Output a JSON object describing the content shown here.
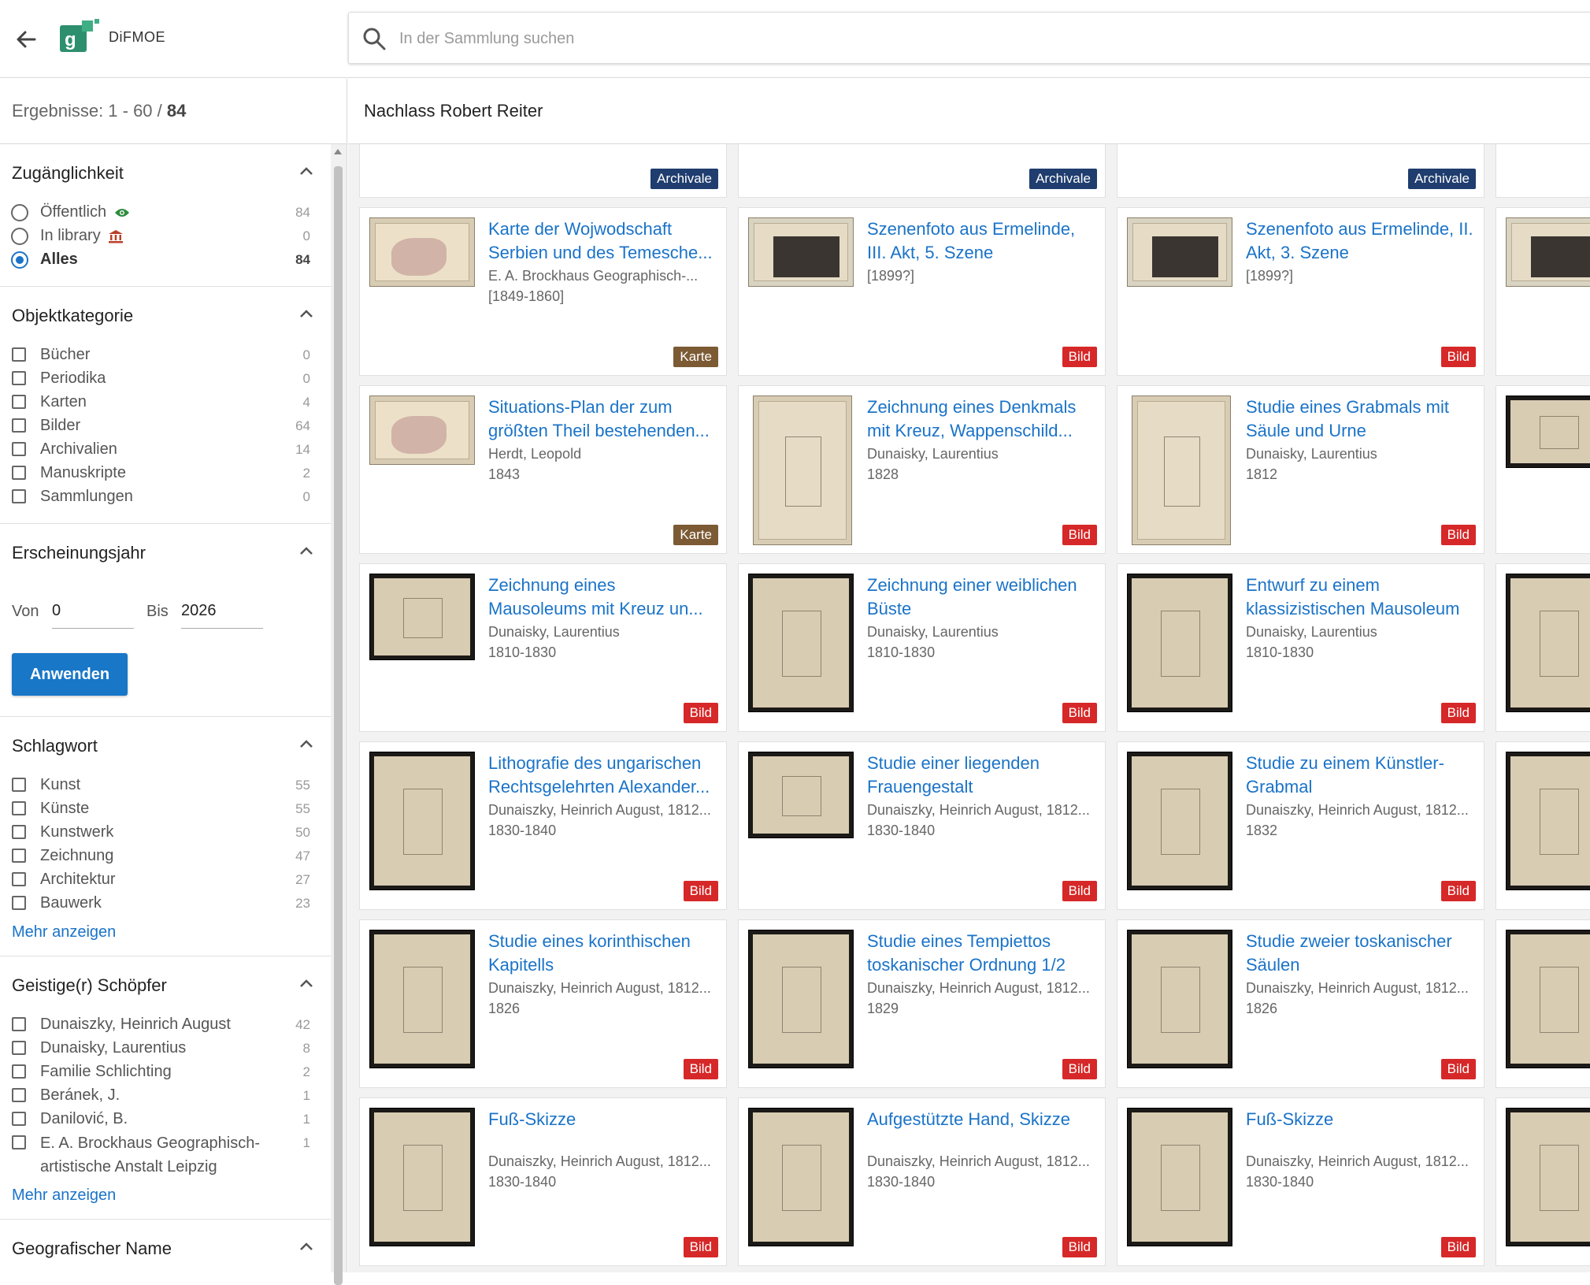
{
  "header": {
    "logo_text": "DiFMOE",
    "search_placeholder": "In der Sammlung suchen"
  },
  "colors": {
    "accent": "#1a73c8",
    "bild": "#d62828",
    "karte": "#7b5a34",
    "archivale": "#1f3d6e"
  },
  "results": {
    "label": "Ergebnisse: 1 - 60 / ",
    "total": "84"
  },
  "collection_title": "Nachlass Robert Reiter",
  "facets": {
    "access": {
      "title": "Zugänglichkeit",
      "items": [
        {
          "label": "Öffentlich",
          "count": "84"
        },
        {
          "label": "In library",
          "count": "0"
        },
        {
          "label": "Alles",
          "count": "84"
        }
      ]
    },
    "category": {
      "title": "Objektkategorie",
      "items": [
        {
          "label": "Bücher",
          "count": "0"
        },
        {
          "label": "Periodika",
          "count": "0"
        },
        {
          "label": "Karten",
          "count": "4"
        },
        {
          "label": "Bilder",
          "count": "64"
        },
        {
          "label": "Archivalien",
          "count": "14"
        },
        {
          "label": "Manuskripte",
          "count": "2"
        },
        {
          "label": "Sammlungen",
          "count": "0"
        }
      ]
    },
    "year": {
      "title": "Erscheinungsjahr",
      "from_label": "Von",
      "from_value": "0",
      "to_label": "Bis",
      "to_value": "2026",
      "apply_label": "Anwenden"
    },
    "keyword": {
      "title": "Schlagwort",
      "items": [
        {
          "label": "Kunst",
          "count": "55"
        },
        {
          "label": "Künste",
          "count": "55"
        },
        {
          "label": "Kunstwerk",
          "count": "50"
        },
        {
          "label": "Zeichnung",
          "count": "47"
        },
        {
          "label": "Architektur",
          "count": "27"
        },
        {
          "label": "Bauwerk",
          "count": "23"
        }
      ],
      "more": "Mehr anzeigen"
    },
    "creator": {
      "title": "Geistige(r) Schöpfer",
      "items": [
        {
          "label": "Dunaiszky, Heinrich August",
          "count": "42"
        },
        {
          "label": "Dunaisky, Laurentius",
          "count": "8"
        },
        {
          "label": "Familie Schlichting",
          "count": "2"
        },
        {
          "label": "Beránek, J.",
          "count": "1"
        },
        {
          "label": "Danilović, B.",
          "count": "1"
        },
        {
          "label": "E. A. Brockhaus Geographisch-artistische Anstalt Leipzig",
          "count": "1"
        }
      ],
      "more": "Mehr anzeigen"
    },
    "geo": {
      "title": "Geografischer Name"
    }
  },
  "top_badges": [
    "Archivale",
    "Archivale",
    "Archivale"
  ],
  "cards": [
    {
      "title": "Karte der Wojwodschaft Serbien und des Temesche...",
      "line1": "E. A. Brockhaus Geographisch-...",
      "line2": "[1849-1860]",
      "badge": "Karte",
      "thumb": "map"
    },
    {
      "title": "Szenenfoto aus Ermelinde, III. Akt, 5. Szene",
      "line1": "[1899?]",
      "line2": "",
      "badge": "Bild",
      "thumb": "photo"
    },
    {
      "title": "Szenenfoto aus Ermelinde, II. Akt, 3. Szene",
      "line1": "[1899?]",
      "line2": "",
      "badge": "Bild",
      "thumb": "photo"
    },
    {
      "title": "Situations-Plan der zum größten Theil bestehenden...",
      "line1": "Herdt, Leopold",
      "line2": "1843",
      "badge": "Karte",
      "thumb": "map"
    },
    {
      "title": "Zeichnung eines Denkmals mit Kreuz, Wappenschild...",
      "line1": "Dunaisky, Laurentius",
      "line2": "1828",
      "badge": "Bild",
      "thumb": "portrait"
    },
    {
      "title": "Studie eines Grabmals mit Säule und Urne",
      "line1": "Dunaisky, Laurentius",
      "line2": "1812",
      "badge": "Bild",
      "thumb": "portrait"
    },
    {
      "title": "Zeichnung eines Mausoleums mit Kreuz un...",
      "line1": "Dunaisky, Laurentius",
      "line2": "1810-1830",
      "badge": "Bild",
      "thumb": "dark"
    },
    {
      "title": "Zeichnung einer weiblichen Büste",
      "line1": "Dunaisky, Laurentius",
      "line2": "1810-1830",
      "badge": "Bild",
      "thumb": "dark-portrait"
    },
    {
      "title": "Entwurf zu einem klassizistischen Mausoleum",
      "line1": "Dunaisky, Laurentius",
      "line2": "1810-1830",
      "badge": "Bild",
      "thumb": "dark-portrait"
    },
    {
      "title": "Lithografie des ungarischen Rechtsgelehrten Alexander...",
      "line1": "Dunaiszky, Heinrich August, 1812...",
      "line2": "1830-1840",
      "badge": "Bild",
      "thumb": "dark-portrait"
    },
    {
      "title": "Studie einer liegenden Frauengestalt",
      "line1": "Dunaiszky, Heinrich August, 1812...",
      "line2": "1830-1840",
      "badge": "Bild",
      "thumb": "dark-square"
    },
    {
      "title": "Studie zu einem Künstler-Grabmal",
      "line1": "Dunaiszky, Heinrich August, 1812...",
      "line2": "1832",
      "badge": "Bild",
      "thumb": "dark-portrait"
    },
    {
      "title": "Studie eines korinthischen Kapitells",
      "line1": "Dunaiszky, Heinrich August, 1812...",
      "line2": "1826",
      "badge": "Bild",
      "thumb": "dark-tall"
    },
    {
      "title": "Studie eines Tempiettos toskanischer Ordnung 1/2",
      "line1": "Dunaiszky, Heinrich August, 1812...",
      "line2": "1829",
      "badge": "Bild",
      "thumb": "dark-tall"
    },
    {
      "title": "Studie zweier toskanischer Säulen",
      "line1": "Dunaiszky, Heinrich August, 1812...",
      "line2": "1826",
      "badge": "Bild",
      "thumb": "dark-tall"
    },
    {
      "title": "Fuß-Skizze",
      "line1": "Dunaiszky, Heinrich August, 1812...",
      "line2": "1830-1840",
      "badge": "Bild",
      "thumb": "dark-tall"
    },
    {
      "title": "Aufgestützte Hand, Skizze",
      "line1": "Dunaiszky, Heinrich August, 1812...",
      "line2": "1830-1840",
      "badge": "Bild",
      "thumb": "dark-tall"
    },
    {
      "title": "Fuß-Skizze",
      "line1": "Dunaiszky, Heinrich August, 1812...",
      "line2": "1830-1840",
      "badge": "Bild",
      "thumb": "dark-tall"
    }
  ]
}
